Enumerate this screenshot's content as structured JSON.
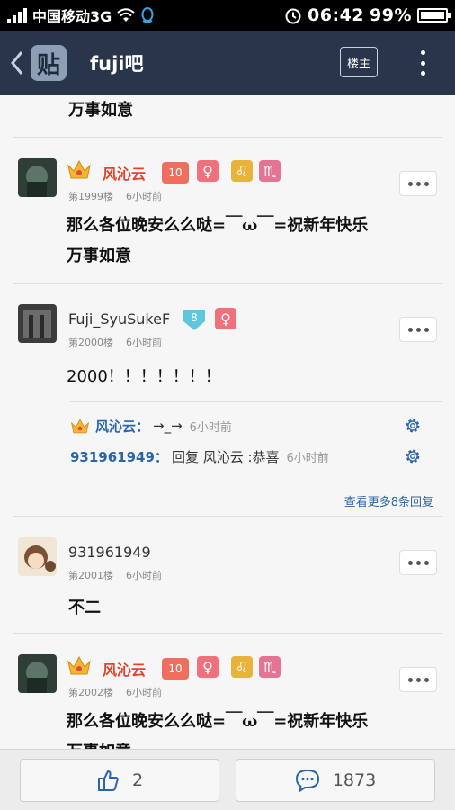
{
  "status_bar": {
    "carrier": "中国移动3G",
    "time": "06:42",
    "battery": "99%",
    "battery_level": 0.99
  },
  "header": {
    "title": "fuji吧",
    "logo_char": "贴",
    "louzhu_label": "楼主"
  },
  "top_partial_text": "万事如意",
  "posts": [
    {
      "username": "风沁云",
      "level": "10",
      "floor": "第1999楼",
      "time": "6小时前",
      "text_line1": "那么各位晚安么么哒=￣ω￣=祝新年快乐",
      "text_line2": "万事如意"
    },
    {
      "username": "Fuji_SyuSukeF",
      "level": "8",
      "floor": "第2000楼",
      "time": "6小时前",
      "text_line1": "2000！！！！！！！",
      "replies": [
        {
          "user": "风沁云：",
          "text": "→_→",
          "time": "6小时前"
        },
        {
          "user": "931961949：",
          "text": "回复 风沁云 :恭喜",
          "time": "6小时前"
        }
      ],
      "more_replies": "查看更多8条回复"
    },
    {
      "username": "931961949",
      "floor": "第2001楼",
      "time": "6小时前",
      "text_line1": "不二"
    },
    {
      "username": "风沁云",
      "level": "10",
      "floor": "第2002楼",
      "time": "6小时前",
      "text_line1": "那么各位晚安么么哒=￣ω￣=祝新年快乐",
      "text_line2": "万事如意"
    }
  ],
  "bottom_bar": {
    "like_count": "2",
    "comment_count": "1873"
  },
  "colors": {
    "header_bg": "#28354a",
    "username_red": "#e0442c",
    "link_blue": "#2a65a8"
  }
}
